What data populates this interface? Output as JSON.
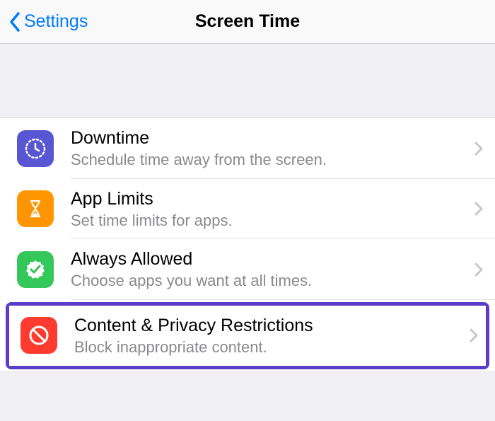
{
  "nav": {
    "back_label": "Settings",
    "title": "Screen Time"
  },
  "items": [
    {
      "title": "Downtime",
      "subtitle": "Schedule time away from the screen."
    },
    {
      "title": "App Limits",
      "subtitle": "Set time limits for apps."
    },
    {
      "title": "Always Allowed",
      "subtitle": "Choose apps you want at all times."
    },
    {
      "title": "Content & Privacy Restrictions",
      "subtitle": "Block inappropriate content."
    }
  ]
}
